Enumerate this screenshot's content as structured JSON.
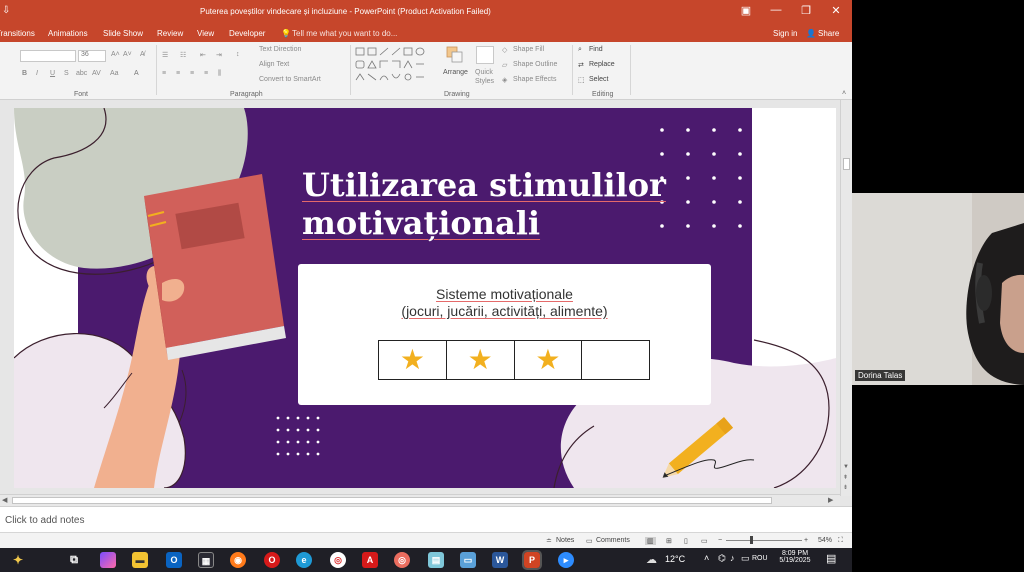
{
  "window": {
    "title": "Puterea poveștilor vindecare și incluziune - PowerPoint (Product Activation Failed)",
    "sign_in": "Sign in",
    "share": "Share"
  },
  "tabs": [
    {
      "label": "Transitions"
    },
    {
      "label": "Animations"
    },
    {
      "label": "Slide Show"
    },
    {
      "label": "Review"
    },
    {
      "label": "View"
    },
    {
      "label": "Developer"
    }
  ],
  "tell_me": "Tell me what you want to do...",
  "ribbon": {
    "font_size": "36",
    "groups": {
      "font": "Font",
      "paragraph": "Paragraph",
      "drawing": "Drawing",
      "editing": "Editing"
    },
    "paragraph": {
      "text_direction": "Text Direction",
      "align_text": "Align Text",
      "convert_smartart": "Convert to SmartArt"
    },
    "drawing": {
      "arrange": "Arrange",
      "quick_styles": "Quick Styles",
      "shape_fill": "Shape Fill",
      "shape_outline": "Shape Outline",
      "shape_effects": "Shape Effects"
    },
    "editing": {
      "find": "Find",
      "replace": "Replace",
      "select": "Select"
    }
  },
  "slide": {
    "title_line1": "Utilizarea stimulilor",
    "title_line2": "motivaționali",
    "card_line1": "Sisteme motivaționale",
    "card_line2": "(jocuri, jucării, activități, alimente)",
    "stars": [
      {
        "filled": true,
        "glyph": "★"
      },
      {
        "filled": true,
        "glyph": "★"
      },
      {
        "filled": true,
        "glyph": "★"
      },
      {
        "filled": false,
        "glyph": ""
      }
    ],
    "colors": {
      "purple": "#4b1a6e",
      "lavender": "#efe6ee",
      "sage": "#c9cec3",
      "book": "#d1605a",
      "star": "#f2b01f",
      "pencil": "#f2b01f"
    }
  },
  "notes_placeholder": "Click to add notes",
  "status": {
    "notes": "Notes",
    "comments": "Comments",
    "zoom": "54%"
  },
  "participant": {
    "name": "Dorina Talas"
  },
  "taskbar": {
    "temperature": "12°C",
    "language": "ROU",
    "time": "8:09 PM",
    "date": "5/19/2025"
  }
}
